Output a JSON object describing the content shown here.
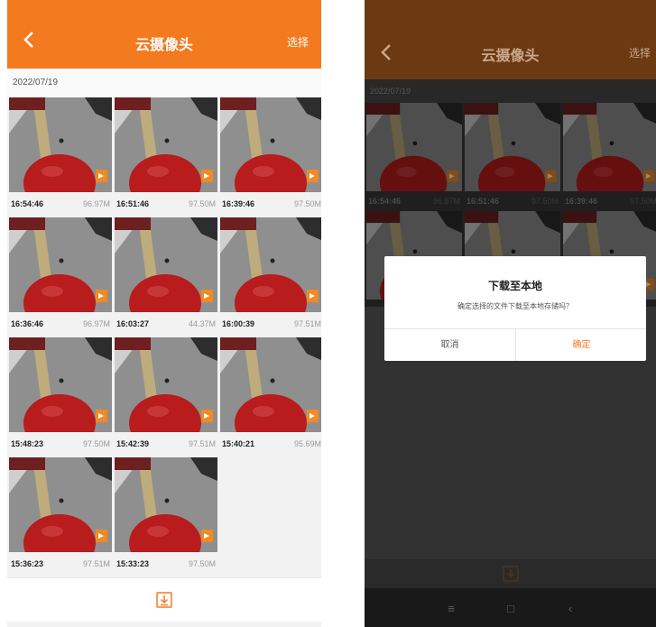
{
  "left_screen": {
    "header": {
      "title": "云摄像头",
      "action": "选择"
    },
    "date": "2022/07/19",
    "thumbnails": [
      {
        "time": "16:54:46",
        "size": "96.97M"
      },
      {
        "time": "16:51:46",
        "size": "97.50M"
      },
      {
        "time": "16:39:46",
        "size": "97.50M"
      },
      {
        "time": "16:36:46",
        "size": "96.97M"
      },
      {
        "time": "16:03:27",
        "size": "44.37M"
      },
      {
        "time": "16:00:39",
        "size": "97.51M"
      },
      {
        "time": "15:48:23",
        "size": "97.50M"
      },
      {
        "time": "15:42:39",
        "size": "97.51M"
      },
      {
        "time": "15:40:21",
        "size": "95.69M"
      },
      {
        "time": "15:36:23",
        "size": "97.51M"
      },
      {
        "time": "15:33:23",
        "size": "97.50M"
      }
    ]
  },
  "right_screen": {
    "header": {
      "title": "云摄像头",
      "action": "选择"
    },
    "date": "2022/07/19",
    "dialog": {
      "title": "下载至本地",
      "message": "确定选择的文件下载至本地存储吗？",
      "cancel": "取消",
      "confirm": "确定"
    }
  },
  "colors": {
    "accent": "#f47a20",
    "accent_dimmed": "#6b3a12"
  }
}
